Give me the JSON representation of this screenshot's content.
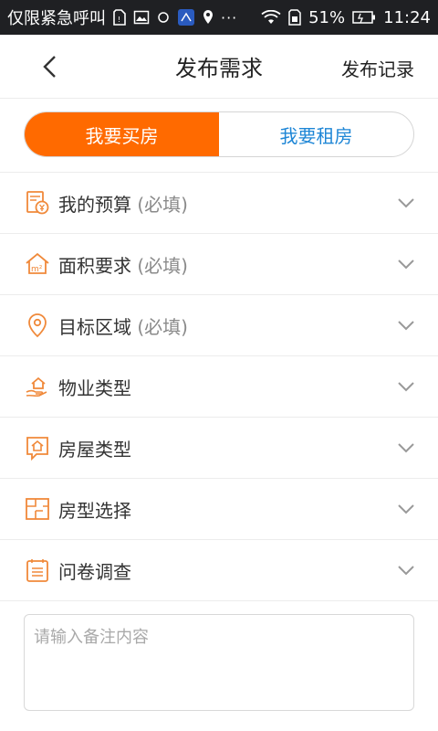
{
  "status_bar": {
    "carrier": "仅限紧急呼叫",
    "battery": "51%",
    "time": "11:24",
    "more": "···"
  },
  "header": {
    "title": "发布需求",
    "history_link": "发布记录"
  },
  "tabs": [
    {
      "label": "我要买房",
      "active": true
    },
    {
      "label": "我要租房",
      "active": false
    }
  ],
  "form_rows": [
    {
      "label": "我的预算",
      "required": " (必填)",
      "icon": "budget-icon"
    },
    {
      "label": "面积要求",
      "required": " (必填)",
      "icon": "area-icon"
    },
    {
      "label": "目标区域",
      "required": " (必填)",
      "icon": "location-pin-icon"
    },
    {
      "label": "物业类型",
      "required": "",
      "icon": "property-hand-house-icon"
    },
    {
      "label": "房屋类型",
      "required": "",
      "icon": "house-type-icon"
    },
    {
      "label": "房型选择",
      "required": "",
      "icon": "floor-plan-icon"
    },
    {
      "label": "问卷调查",
      "required": "",
      "icon": "questionnaire-icon"
    }
  ],
  "note": {
    "placeholder": "请输入备注内容",
    "value": ""
  },
  "colors": {
    "accent": "#ff6a00",
    "link_blue": "#1e86d6",
    "icon_orange": "#f0893a",
    "status_bar_bg": "#1f2023"
  }
}
